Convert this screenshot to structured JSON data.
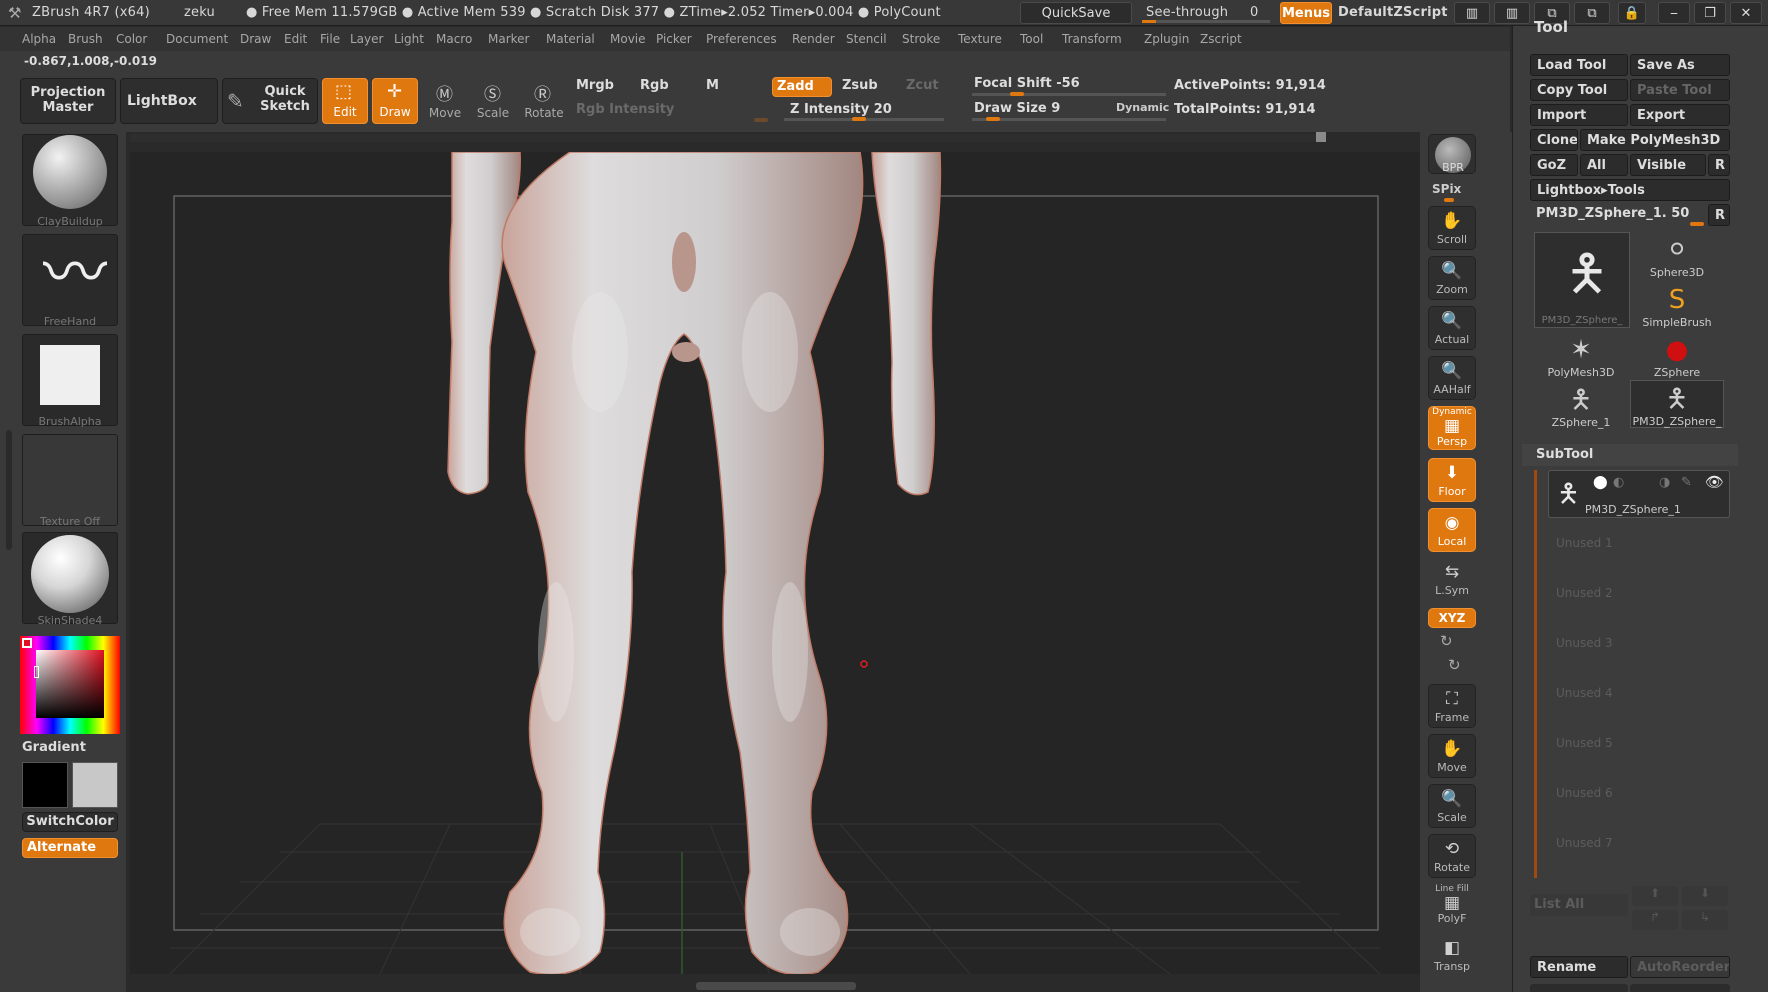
{
  "titlebar": {
    "app": "ZBrush 4R7 (x64)",
    "user": "zeku",
    "status": "● Free Mem 11.579GB ● Active Mem 539 ● Scratch Disk 377 ● ZTime▸2.052 Timer▸0.004 ● PolyCount",
    "quicksave": "QuickSave",
    "seethrough": "See-through",
    "seethrough_value": "0",
    "menus": "Menus",
    "script": "DefaultZScript",
    "accent": "#e07810"
  },
  "menu": [
    "Alpha",
    "Brush",
    "Color",
    "Document",
    "Draw",
    "Edit",
    "File",
    "Layer",
    "Light",
    "Macro",
    "Marker",
    "Material",
    "Movie",
    "Picker",
    "Preferences",
    "Render",
    "Stencil",
    "Stroke",
    "Texture",
    "Tool",
    "Transform",
    "Zplugin",
    "Zscript"
  ],
  "coords": "-0.867,1.008,-0.019",
  "shelf": {
    "projection_master": "Projection Master",
    "lightbox": "LightBox",
    "quick_sketch": "Quick Sketch",
    "edit": "Edit",
    "draw": "Draw",
    "move": "Move",
    "scale": "Scale",
    "rotate": "Rotate",
    "mrgb": "Mrgb",
    "rgb": "Rgb",
    "m": "M",
    "rgb_intensity": "Rgb Intensity",
    "zadd": "Zadd",
    "zsub": "Zsub",
    "zcut": "Zcut",
    "z_intensity": "Z Intensity 20",
    "focal_shift": "Focal Shift -56",
    "draw_size": "Draw Size 9",
    "dynamic": "Dynamic",
    "active_points": "ActivePoints: 91,914",
    "total_points": "TotalPoints: 91,914"
  },
  "left": {
    "brush": "ClayBuildup",
    "stroke": "FreeHand",
    "alpha": "BrushAlpha",
    "texture": "Texture Off",
    "material": "SkinShade4",
    "gradient": "Gradient",
    "switch_color": "SwitchColor",
    "alternate": "Alternate"
  },
  "nav": {
    "bpr": "BPR",
    "spix": "SPix",
    "scroll": "Scroll",
    "zoom": "Zoom",
    "actual": "Actual",
    "aahalf": "AAHalf",
    "dynamic": "Dynamic",
    "persp": "Persp",
    "floor": "Floor",
    "local": "Local",
    "lsym": "L.Sym",
    "xyz": "XYZ",
    "frame": "Frame",
    "move": "Move",
    "scale": "Scale",
    "rotate": "Rotate",
    "linefill": "Line Fill",
    "polyf": "PolyF",
    "transp": "Transp"
  },
  "tool": {
    "title": "Tool",
    "load": "Load Tool",
    "saveas": "Save As",
    "copy": "Copy Tool",
    "paste": "Paste Tool",
    "import": "Import",
    "export": "Export",
    "clone": "Clone",
    "make_poly": "Make PolyMesh3D",
    "goz": "GoZ",
    "all": "All",
    "visible": "Visible",
    "r": "R",
    "lightbox_tools": "Lightbox▸Tools",
    "current": "PM3D_ZSphere_1. 50",
    "tiles": [
      "PM3D_ZSphere_",
      "Sphere3D",
      "SimpleBrush",
      "PolyMesh3D",
      "ZSphere",
      "ZSphere_1",
      "PM3D_ZSphere_"
    ]
  },
  "subtool": {
    "title": "SubTool",
    "active": "PM3D_ZSphere_1",
    "unused": [
      "Unused 1",
      "Unused 2",
      "Unused 3",
      "Unused 4",
      "Unused 5",
      "Unused 6",
      "Unused 7"
    ],
    "list_all": "List All",
    "rename": "Rename",
    "autoreorder": "AutoReorder"
  }
}
